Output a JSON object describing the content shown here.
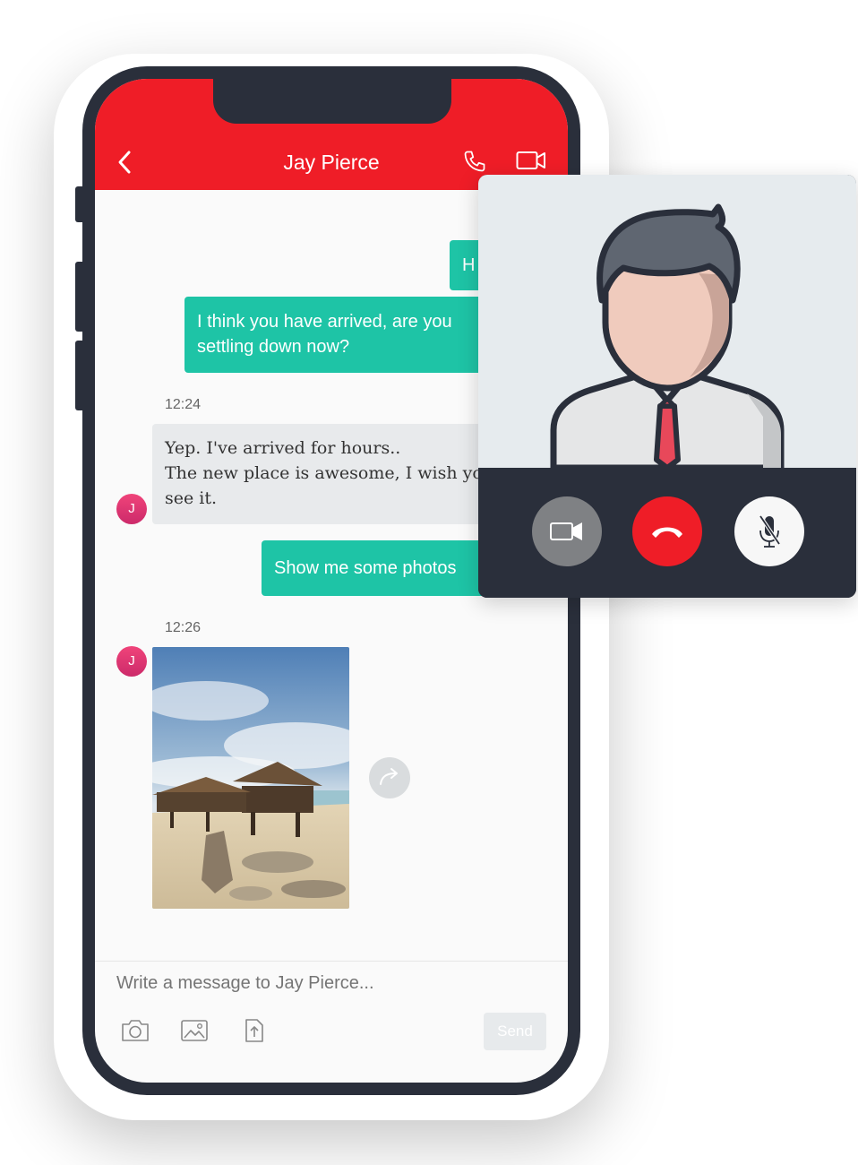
{
  "header": {
    "title": "Jay Pierce"
  },
  "messages": {
    "out_first_partial": "H",
    "out_arrived_line1": "I think you have arrived, are you",
    "out_arrived_line2": "settling down now?",
    "time_1": "12:24",
    "in_line1": "Yep. I've arrived for hours..",
    "in_line2": "The new place is awesome, I wish you can",
    "in_line3": "see it.",
    "out_photos": "Show me some photos",
    "time_2": "12:26",
    "avatar_initial": "J"
  },
  "composer": {
    "placeholder": "Write a message to Jay Pierce...",
    "send_label": "Send"
  },
  "icons": {
    "back": "chevron-left-icon",
    "call": "phone-icon",
    "video": "video-camera-icon",
    "share": "share-arrow-icon",
    "camera": "camera-icon",
    "gallery": "image-icon",
    "upload": "file-upload-icon",
    "call_camera": "video-camera-icon",
    "hang_up": "hang-up-icon",
    "mute": "mic-muted-icon"
  },
  "colors": {
    "header": "#ef1d27",
    "outgoing_bubble": "#1ec4a6",
    "incoming_bubble": "#e8eaec",
    "phone_frame": "#2a2f3b",
    "hang_up": "#ef1d27"
  }
}
